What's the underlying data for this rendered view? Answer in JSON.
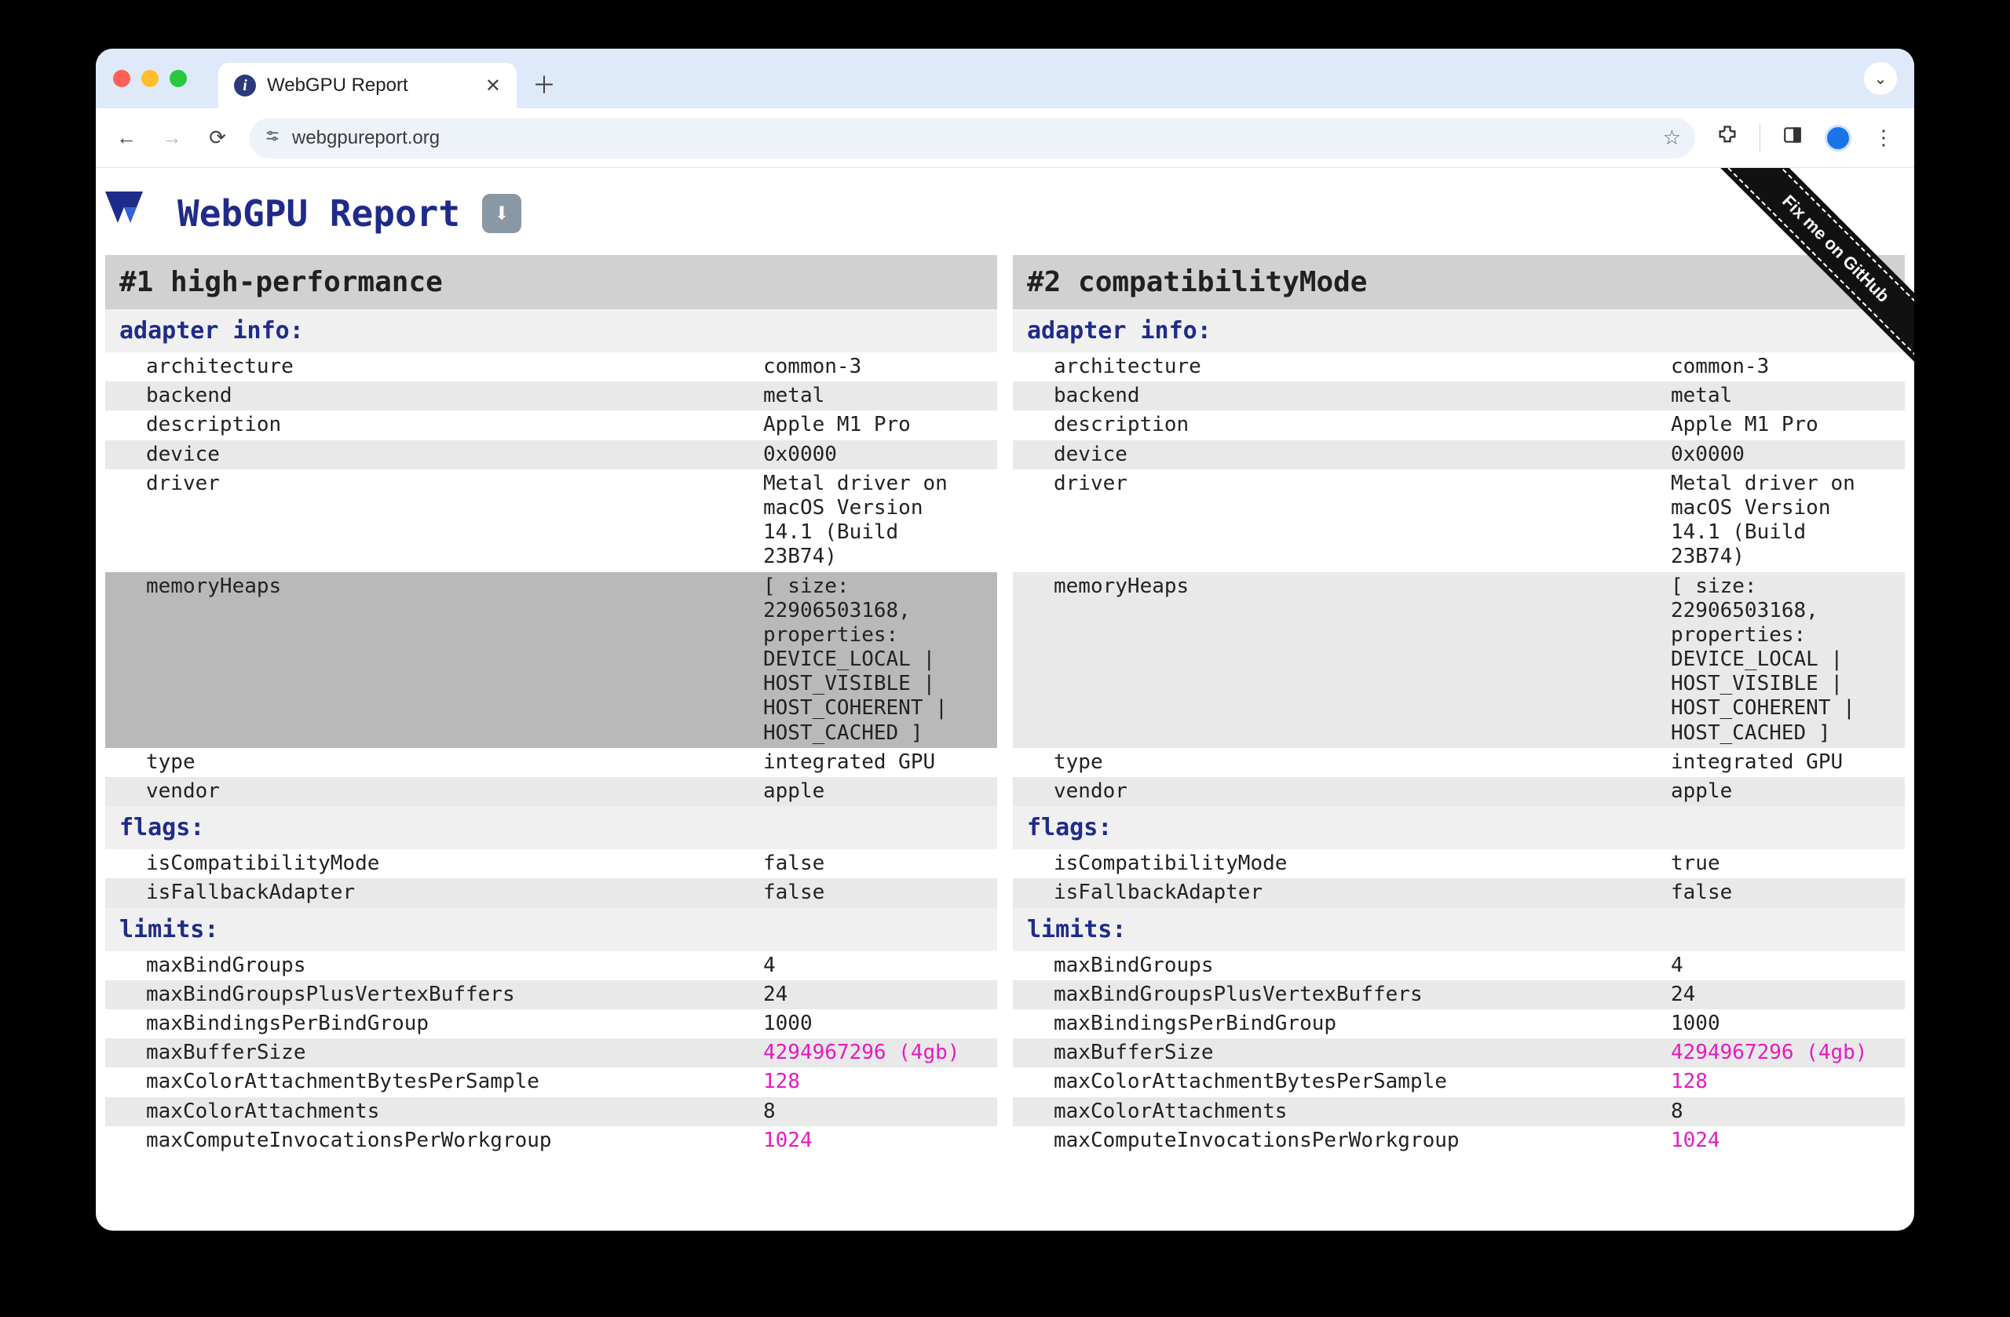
{
  "browser": {
    "tab_title": "WebGPU Report",
    "favicon_letter": "i",
    "url": "webgpureport.org",
    "site_chip_text": ""
  },
  "page": {
    "title": "WebGPU Report",
    "download_glyph": "⬇",
    "ribbon_text": "Fix me on GitHub"
  },
  "columns": [
    {
      "heading": "#1 high-performance",
      "sections": [
        {
          "title": "adapter info:",
          "rows": [
            {
              "k": "architecture",
              "v": "common-3"
            },
            {
              "k": "backend",
              "v": "metal"
            },
            {
              "k": "description",
              "v": "Apple M1 Pro"
            },
            {
              "k": "device",
              "v": "0x0000"
            },
            {
              "k": "driver",
              "v": "Metal driver on macOS Version 14.1 (Build 23B74)"
            },
            {
              "k": "memoryHeaps",
              "v": "[ size: 22906503168, properties: DEVICE_LOCAL | HOST_VISIBLE | HOST_COHERENT | HOST_CACHED ]",
              "hi": true
            },
            {
              "k": "type",
              "v": "integrated GPU"
            },
            {
              "k": "vendor",
              "v": "apple"
            }
          ]
        },
        {
          "title": "flags:",
          "rows": [
            {
              "k": "isCompatibilityMode",
              "v": "false"
            },
            {
              "k": "isFallbackAdapter",
              "v": "false"
            }
          ]
        },
        {
          "title": "limits:",
          "rows": [
            {
              "k": "maxBindGroups",
              "v": "4"
            },
            {
              "k": "maxBindGroupsPlusVertexBuffers",
              "v": "24"
            },
            {
              "k": "maxBindingsPerBindGroup",
              "v": "1000"
            },
            {
              "k": "maxBufferSize",
              "v": "4294967296 (4gb)",
              "nondefault": true
            },
            {
              "k": "maxColorAttachmentBytesPerSample",
              "v": "128",
              "nondefault": true
            },
            {
              "k": "maxColorAttachments",
              "v": "8"
            },
            {
              "k": "maxComputeInvocationsPerWorkgroup",
              "v": "1024",
              "nondefault": true
            }
          ]
        }
      ]
    },
    {
      "heading": "#2 compatibilityMode",
      "sections": [
        {
          "title": "adapter info:",
          "rows": [
            {
              "k": "architecture",
              "v": "common-3"
            },
            {
              "k": "backend",
              "v": "metal"
            },
            {
              "k": "description",
              "v": "Apple M1 Pro"
            },
            {
              "k": "device",
              "v": "0x0000"
            },
            {
              "k": "driver",
              "v": "Metal driver on macOS Version 14.1 (Build 23B74)"
            },
            {
              "k": "memoryHeaps",
              "v": "[ size: 22906503168, properties: DEVICE_LOCAL | HOST_VISIBLE | HOST_COHERENT | HOST_CACHED ]"
            },
            {
              "k": "type",
              "v": "integrated GPU"
            },
            {
              "k": "vendor",
              "v": "apple"
            }
          ]
        },
        {
          "title": "flags:",
          "rows": [
            {
              "k": "isCompatibilityMode",
              "v": "true"
            },
            {
              "k": "isFallbackAdapter",
              "v": "false"
            }
          ]
        },
        {
          "title": "limits:",
          "rows": [
            {
              "k": "maxBindGroups",
              "v": "4"
            },
            {
              "k": "maxBindGroupsPlusVertexBuffers",
              "v": "24"
            },
            {
              "k": "maxBindingsPerBindGroup",
              "v": "1000"
            },
            {
              "k": "maxBufferSize",
              "v": "4294967296 (4gb)",
              "nondefault": true
            },
            {
              "k": "maxColorAttachmentBytesPerSample",
              "v": "128",
              "nondefault": true
            },
            {
              "k": "maxColorAttachments",
              "v": "8"
            },
            {
              "k": "maxComputeInvocationsPerWorkgroup",
              "v": "1024",
              "nondefault": true
            }
          ]
        }
      ]
    }
  ]
}
